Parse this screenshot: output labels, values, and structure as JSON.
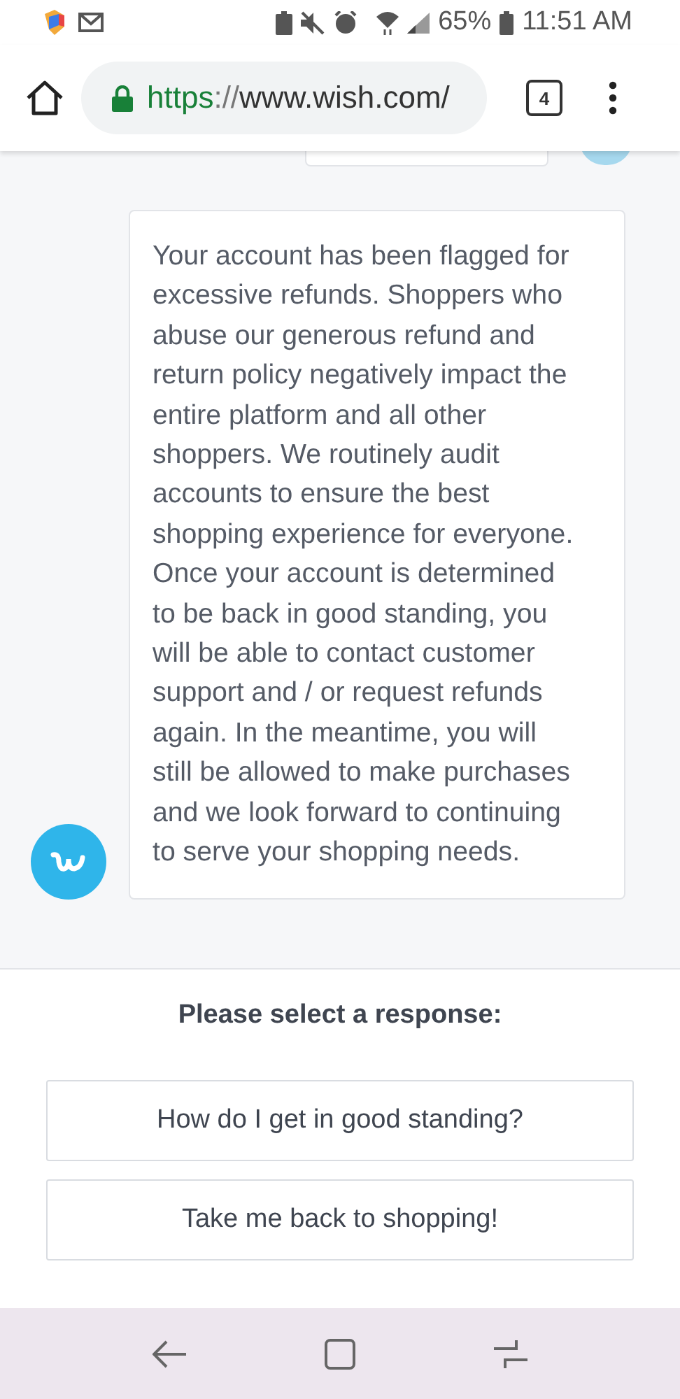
{
  "status_bar": {
    "battery": "65%",
    "time": "11:51 AM"
  },
  "browser": {
    "url_scheme": "https",
    "url_separator": "://",
    "url_host": "www.wish.com/",
    "tab_count": "4"
  },
  "chat": {
    "message": "Your account has been flagged for excessive refunds. Shoppers who abuse our generous refund and return policy negatively impact the entire platform and all other shoppers. We routinely audit accounts to ensure the best shopping experience for everyone. Once your account is determined to be back in good standing, you will be able to contact customer support and / or request refunds again. In the meantime, you will still be allowed to make purchases and we look forward to continuing to serve your shopping needs."
  },
  "responses": {
    "prompt": "Please select a response:",
    "options": [
      "How do I get in good standing?",
      "Take me back to shopping!"
    ]
  }
}
